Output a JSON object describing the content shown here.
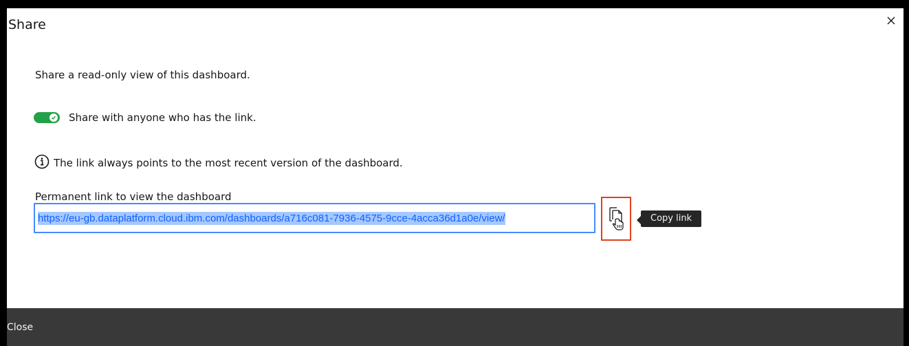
{
  "dialog": {
    "title": "Share",
    "close_icon": "close-icon",
    "intro_text": "Share a read-only view of this dashboard.",
    "toggle": {
      "label": "Share with anyone who has the link.",
      "state": "on",
      "color": "#24a148"
    },
    "info": {
      "icon": "info-icon",
      "text": "The link always points to the most recent version of the dashboard."
    },
    "link": {
      "label": "Permanent link to view the dashboard",
      "value": "https://eu-gb.dataplatform.cloud.ibm.com/dashboards/a716c081-7936-4575-9cce-4acca36d1a0e/view/"
    },
    "copy_button": {
      "icon": "copy-icon",
      "tooltip": "Copy link"
    },
    "footer": {
      "close_label": "Close"
    }
  }
}
